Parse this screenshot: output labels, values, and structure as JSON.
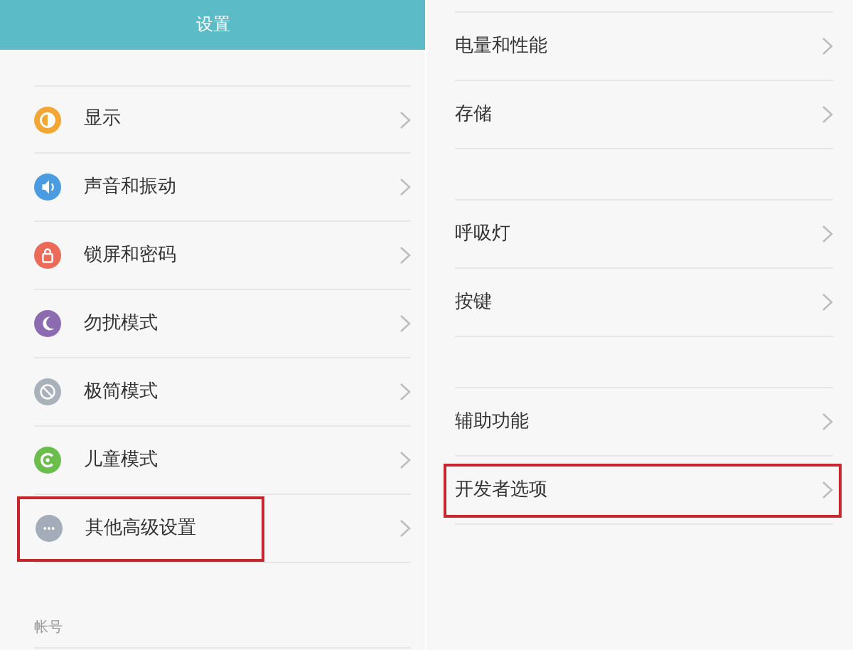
{
  "left_screen": {
    "title": "设置",
    "rows": [
      {
        "label": "显示",
        "color": "#f2a634",
        "highlighted": false
      },
      {
        "label": "声音和振动",
        "color": "#4b9be0",
        "highlighted": false
      },
      {
        "label": "锁屏和密码",
        "color": "#ec6b58",
        "highlighted": false
      },
      {
        "label": "勿扰模式",
        "color": "#8c6bb1",
        "highlighted": false
      },
      {
        "label": "极简模式",
        "color": "#a9b1ba",
        "highlighted": false
      },
      {
        "label": "儿童模式",
        "color": "#6bbd4c",
        "highlighted": false
      },
      {
        "label": "其他高级设置",
        "color": "#a3acb8",
        "highlighted": true
      }
    ],
    "section_label": "帐号"
  },
  "right_screen": {
    "groups": [
      {
        "rows": [
          {
            "label": "电量和性能",
            "highlighted": false
          },
          {
            "label": "存储",
            "highlighted": false
          }
        ]
      },
      {
        "rows": [
          {
            "label": "呼吸灯",
            "highlighted": false
          },
          {
            "label": "按键",
            "highlighted": false
          }
        ]
      },
      {
        "rows": [
          {
            "label": "辅助功能",
            "highlighted": false
          },
          {
            "label": "开发者选项",
            "highlighted": true
          }
        ]
      }
    ]
  }
}
